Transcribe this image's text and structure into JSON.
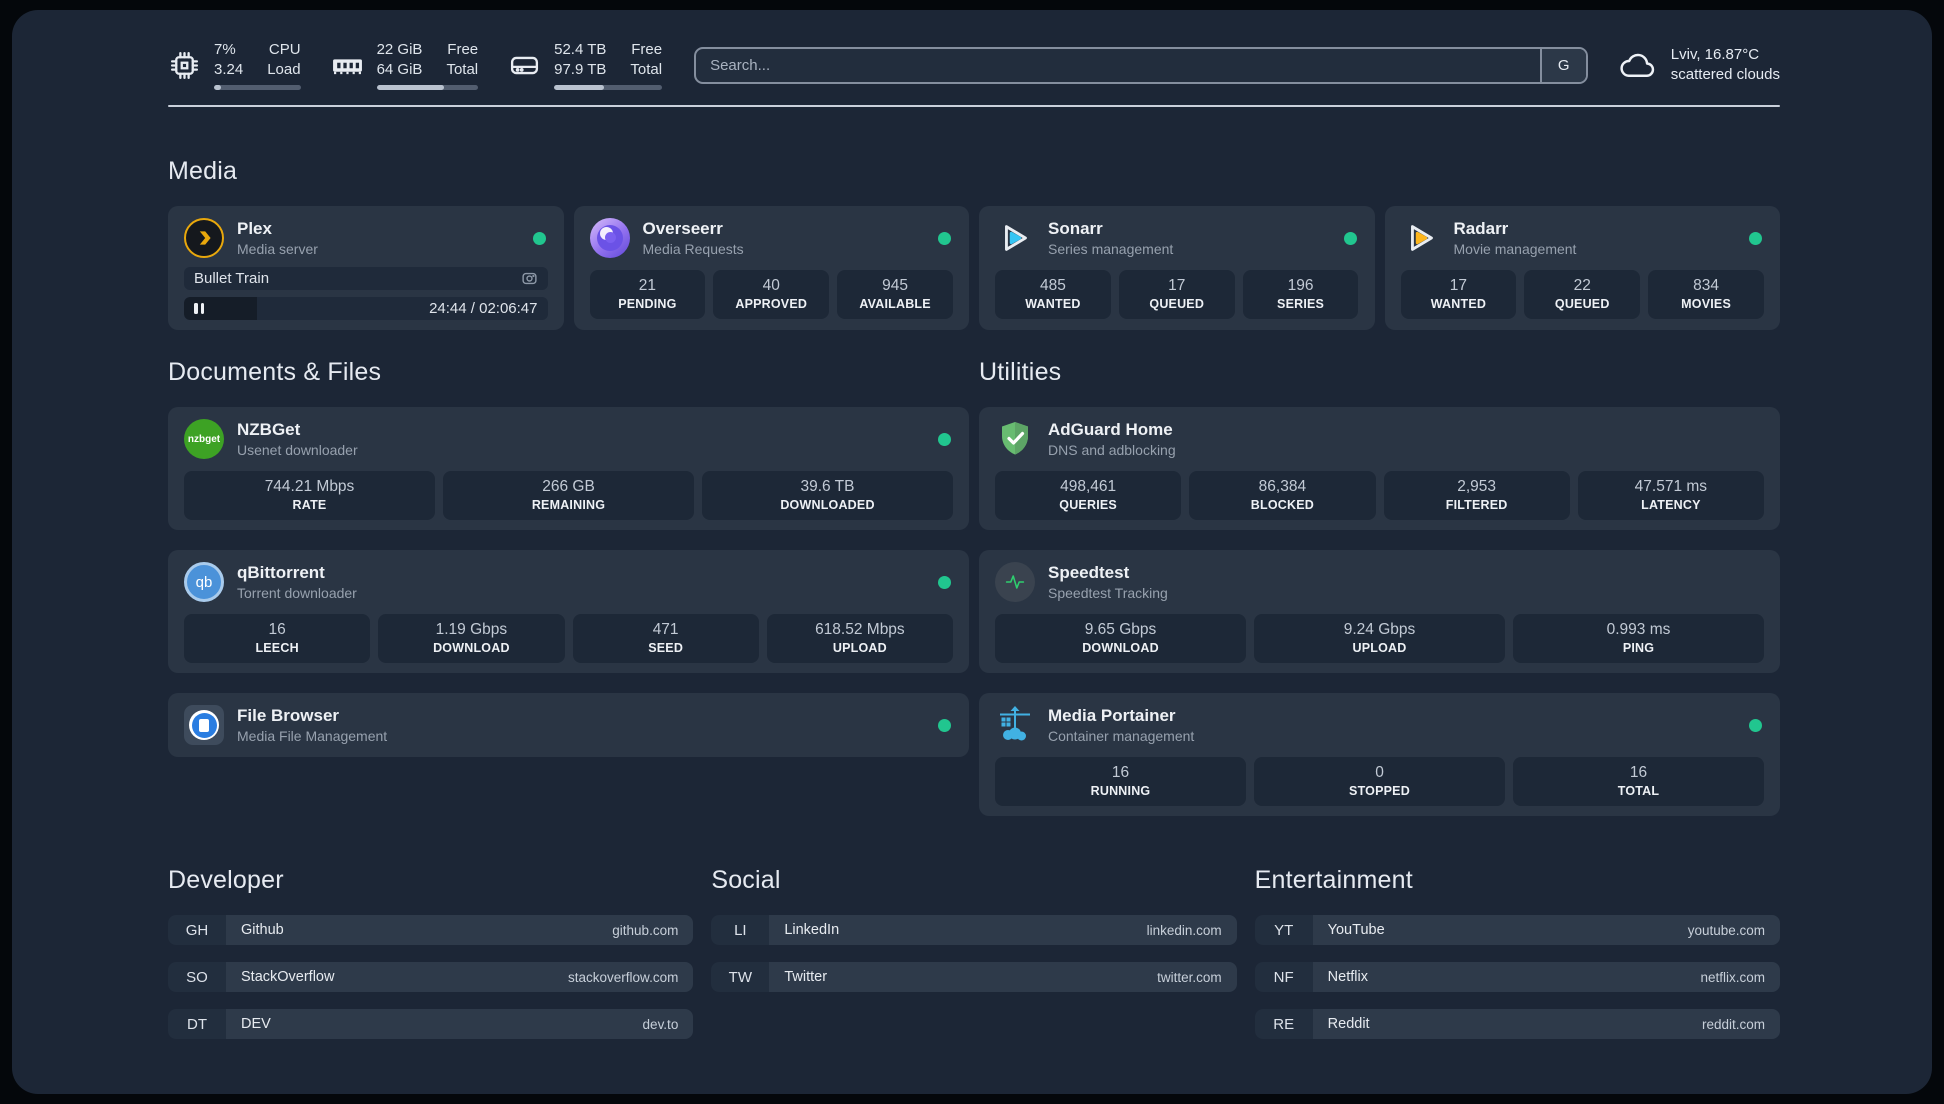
{
  "topbar": {
    "widgets": [
      {
        "icon": "cpu-icon",
        "value_top": "7%",
        "value_bottom": "3.24",
        "label_top": "CPU",
        "label_bottom": "Load",
        "progress_pct": 8
      },
      {
        "icon": "ram-icon",
        "value_top": "22 GiB",
        "value_bottom": "64 GiB",
        "label_top": "Free",
        "label_bottom": "Total",
        "progress_pct": 66
      },
      {
        "icon": "disk-icon",
        "value_top": "52.4 TB",
        "value_bottom": "97.9 TB",
        "label_top": "Free",
        "label_bottom": "Total",
        "progress_pct": 46
      }
    ],
    "search": {
      "placeholder": "Search...",
      "button_label": "G"
    },
    "weather": {
      "location_temp": "Lviv, 16.87°C",
      "condition": "scattered clouds"
    }
  },
  "sections": {
    "media": "Media",
    "documents": "Documents & Files",
    "utilities": "Utilities"
  },
  "cards": {
    "plex": {
      "title": "Plex",
      "subtitle": "Media server",
      "now_playing": "Bullet Train",
      "elapsed_total": "24:44 / 02:06:47",
      "progress_pct": 20
    },
    "overseerr": {
      "title": "Overseerr",
      "subtitle": "Media Requests",
      "stats": [
        {
          "value": "21",
          "label": "PENDING"
        },
        {
          "value": "40",
          "label": "APPROVED"
        },
        {
          "value": "945",
          "label": "AVAILABLE"
        }
      ]
    },
    "sonarr": {
      "title": "Sonarr",
      "subtitle": "Series management",
      "stats": [
        {
          "value": "485",
          "label": "WANTED"
        },
        {
          "value": "17",
          "label": "QUEUED"
        },
        {
          "value": "196",
          "label": "SERIES"
        }
      ]
    },
    "radarr": {
      "title": "Radarr",
      "subtitle": "Movie management",
      "stats": [
        {
          "value": "17",
          "label": "WANTED"
        },
        {
          "value": "22",
          "label": "QUEUED"
        },
        {
          "value": "834",
          "label": "MOVIES"
        }
      ]
    },
    "nzbget": {
      "title": "NZBGet",
      "subtitle": "Usenet downloader",
      "stats": [
        {
          "value": "744.21 Mbps",
          "label": "RATE"
        },
        {
          "value": "266 GB",
          "label": "REMAINING"
        },
        {
          "value": "39.6 TB",
          "label": "DOWNLOADED"
        }
      ]
    },
    "qbittorrent": {
      "title": "qBittorrent",
      "subtitle": "Torrent downloader",
      "stats": [
        {
          "value": "16",
          "label": "LEECH"
        },
        {
          "value": "1.19 Gbps",
          "label": "DOWNLOAD"
        },
        {
          "value": "471",
          "label": "SEED"
        },
        {
          "value": "618.52 Mbps",
          "label": "UPLOAD"
        }
      ]
    },
    "filebrowser": {
      "title": "File Browser",
      "subtitle": "Media File Management"
    },
    "adguard": {
      "title": "AdGuard Home",
      "subtitle": "DNS and adblocking",
      "stats": [
        {
          "value": "498,461",
          "label": "QUERIES"
        },
        {
          "value": "86,384",
          "label": "BLOCKED"
        },
        {
          "value": "2,953",
          "label": "FILTERED"
        },
        {
          "value": "47.571 ms",
          "label": "LATENCY"
        }
      ]
    },
    "speedtest": {
      "title": "Speedtest",
      "subtitle": "Speedtest Tracking",
      "stats": [
        {
          "value": "9.65 Gbps",
          "label": "DOWNLOAD"
        },
        {
          "value": "9.24 Gbps",
          "label": "UPLOAD"
        },
        {
          "value": "0.993 ms",
          "label": "PING"
        }
      ]
    },
    "portainer": {
      "title": "Media Portainer",
      "subtitle": "Container management",
      "stats": [
        {
          "value": "16",
          "label": "RUNNING"
        },
        {
          "value": "0",
          "label": "STOPPED"
        },
        {
          "value": "16",
          "label": "TOTAL"
        }
      ]
    }
  },
  "icon_labels": {
    "nzbget": "nzbget",
    "qbittorrent": "qb"
  },
  "bookmarks": [
    {
      "title": "Developer",
      "items": [
        {
          "abbr": "GH",
          "name": "Github",
          "domain": "github.com"
        },
        {
          "abbr": "SO",
          "name": "StackOverflow",
          "domain": "stackoverflow.com"
        },
        {
          "abbr": "DT",
          "name": "DEV",
          "domain": "dev.to"
        }
      ]
    },
    {
      "title": "Social",
      "items": [
        {
          "abbr": "LI",
          "name": "LinkedIn",
          "domain": "linkedin.com"
        },
        {
          "abbr": "TW",
          "name": "Twitter",
          "domain": "twitter.com"
        }
      ]
    },
    {
      "title": "Entertainment",
      "items": [
        {
          "abbr": "YT",
          "name": "YouTube",
          "domain": "youtube.com"
        },
        {
          "abbr": "NF",
          "name": "Netflix",
          "domain": "netflix.com"
        },
        {
          "abbr": "RE",
          "name": "Reddit",
          "domain": "reddit.com"
        }
      ]
    }
  ],
  "colors": {
    "status_online": "#21c68f",
    "plex_accent": "#e9a80c",
    "sonarr_accent": "#35c5f4",
    "radarr_accent": "#fdb61d",
    "adguard_accent": "#68bc71",
    "portainer_accent": "#41b1e3"
  }
}
